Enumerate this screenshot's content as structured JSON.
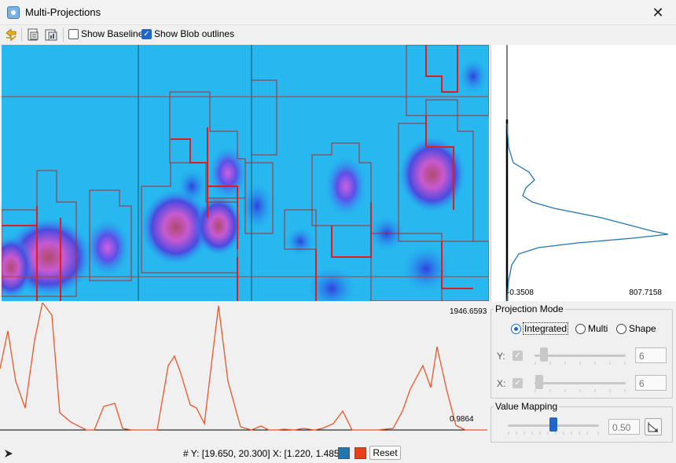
{
  "window": {
    "title": "Multi-Projections",
    "close_icon": "close-icon",
    "app_icon": "app-icon"
  },
  "toolbar": {
    "icons": [
      "swap-axes-icon",
      "copy-data-icon",
      "copy-image-icon"
    ],
    "show_baseline": {
      "label": "Show Baseline",
      "checked": false
    },
    "show_blob_outlines": {
      "label": "Show Blob outlines",
      "checked": true
    }
  },
  "vertical_projection": {
    "min_label": "-0.3508",
    "max_label": "807.7158",
    "line_color": "#1f77b4"
  },
  "horizontal_projection": {
    "max_label": "1946.6593",
    "min_label": "0.9864",
    "line_color": "#e8572a"
  },
  "projection_mode": {
    "title": "Projection Mode",
    "options": [
      {
        "label": "Integrated",
        "selected": true
      },
      {
        "label": "Multi",
        "selected": false
      },
      {
        "label": "Shape",
        "selected": false
      }
    ],
    "y_label": "Y:",
    "y_value": "6",
    "y_level": 0.1,
    "x_label": "X:",
    "x_value": "6",
    "x_level": 0.05
  },
  "value_mapping": {
    "title": "Value Mapping",
    "value": "0.50",
    "level": 0.5
  },
  "status": {
    "cursor_icon": "arrow-cursor-icon",
    "coordinates": "# Y: [19.650, 20.300] X: [1.220, 1.485]",
    "swatch_colors": [
      "#1f77b4",
      "#e8401a"
    ],
    "reset_label": "Reset"
  }
}
